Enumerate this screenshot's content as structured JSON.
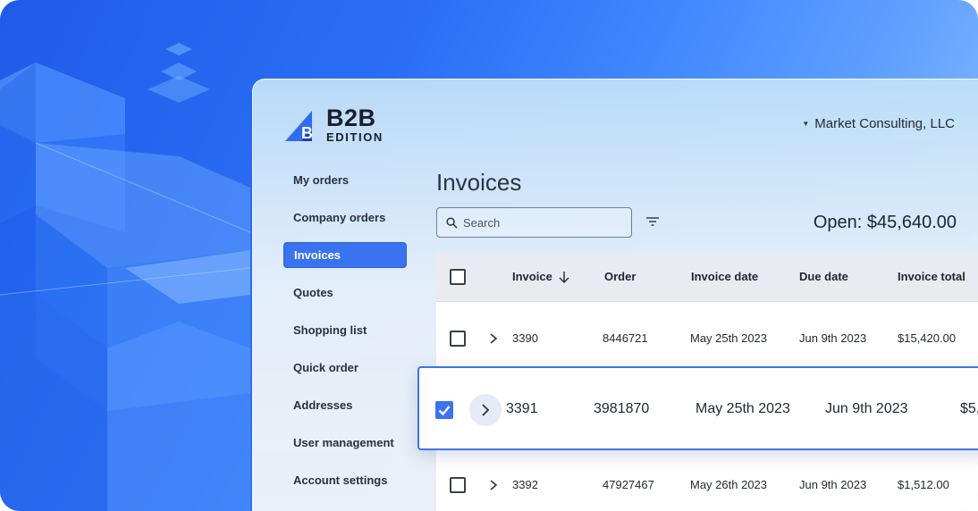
{
  "brand": {
    "line1": "B2B",
    "line2": "EDITION",
    "mark": "B",
    "accent": "#3a73ef"
  },
  "account": {
    "company": "Market Consulting, LLC"
  },
  "nav": {
    "items": [
      {
        "label": "My orders"
      },
      {
        "label": "Company orders"
      },
      {
        "label": "Invoices",
        "active": true
      },
      {
        "label": "Quotes"
      },
      {
        "label": "Shopping list"
      },
      {
        "label": "Quick order"
      },
      {
        "label": "Addresses"
      },
      {
        "label": "User management"
      },
      {
        "label": "Account settings"
      }
    ]
  },
  "page": {
    "title": "Invoices",
    "search_placeholder": "Search",
    "open_total": "Open: $45,640.00"
  },
  "table": {
    "columns": [
      "Invoice",
      "Order",
      "Invoice date",
      "Due date",
      "Invoice total"
    ],
    "rows": [
      {
        "invoice": "3390",
        "order": "8446721",
        "invoice_date": "May 25th 2023",
        "due_date": "Jun 9th 2023",
        "total": "$15,420.00",
        "checked": false
      },
      {
        "invoice": "3391",
        "order": "3981870",
        "invoice_date": "May 25th 2023",
        "due_date": "Jun 9th 2023",
        "total": "$5,",
        "checked": true
      },
      {
        "invoice": "3392",
        "order": "47927467",
        "invoice_date": "May 26th 2023",
        "due_date": "Jun 9th 2023",
        "total": "$1,512.00",
        "checked": false
      }
    ]
  },
  "icons": {
    "search": "search-icon",
    "filter": "filter-icon",
    "sort": "arrow-down-icon",
    "expand": "chevron-right-icon",
    "caret": "caret-down-icon"
  }
}
